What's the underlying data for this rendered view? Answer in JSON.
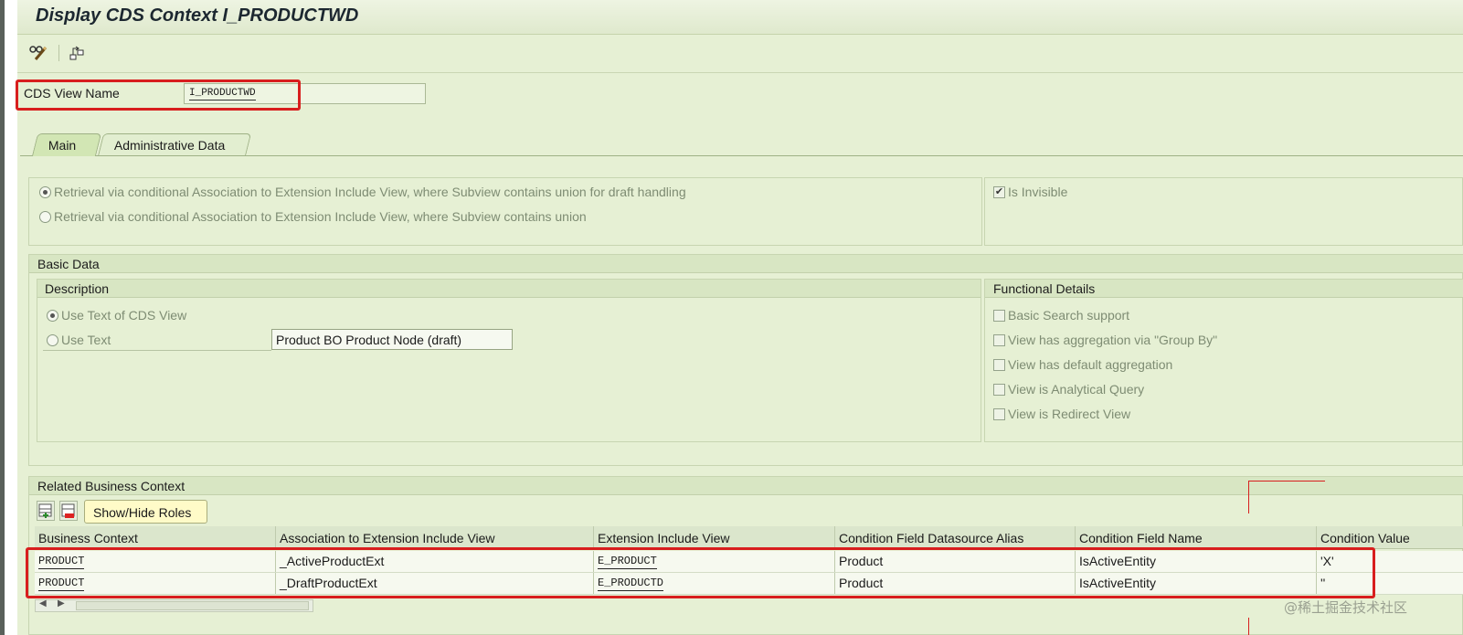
{
  "title": "Display CDS Context I_PRODUCTWD",
  "cds_view": {
    "label": "CDS View Name",
    "value": "I_PRODUCTWD"
  },
  "tabs": [
    {
      "label": "Main"
    },
    {
      "label": "Administrative Data"
    }
  ],
  "retrieval": {
    "options": [
      "Retrieval via conditional Association to Extension Include View, where Subview contains union for draft handling",
      "Retrieval via conditional Association to Extension Include View, where Subview contains union"
    ],
    "is_invisible": "Is Invisible"
  },
  "basic_data": {
    "title": "Basic Data",
    "description": {
      "title": "Description",
      "use_cds_text": "Use Text of CDS View",
      "use_text": "Use Text",
      "text_value": "Product BO Product Node (draft)"
    },
    "functional": {
      "title": "Functional Details",
      "items": [
        "Basic Search support",
        "View has aggregation via \"Group By\"",
        "View has default aggregation",
        "View is Analytical Query",
        "View is Redirect View"
      ]
    }
  },
  "related": {
    "title": "Related Business Context",
    "show_hide": "Show/Hide Roles",
    "columns": [
      "Business Context",
      "Association to Extension Include View",
      "Extension Include View",
      "Condition Field Datasource Alias",
      "Condition Field Name",
      "Condition Value"
    ],
    "rows": [
      [
        "PRODUCT",
        "_ActiveProductExt",
        "E_PRODUCT",
        "Product",
        "IsActiveEntity",
        "'X'"
      ],
      [
        "PRODUCT",
        "_DraftProductExt",
        "E_PRODUCTD",
        "Product",
        "IsActiveEntity",
        "''"
      ]
    ]
  },
  "watermark": "@稀土掘金技术社区",
  "colors": {
    "highlight": "#d81e1e",
    "background": "#e6f0d4"
  }
}
